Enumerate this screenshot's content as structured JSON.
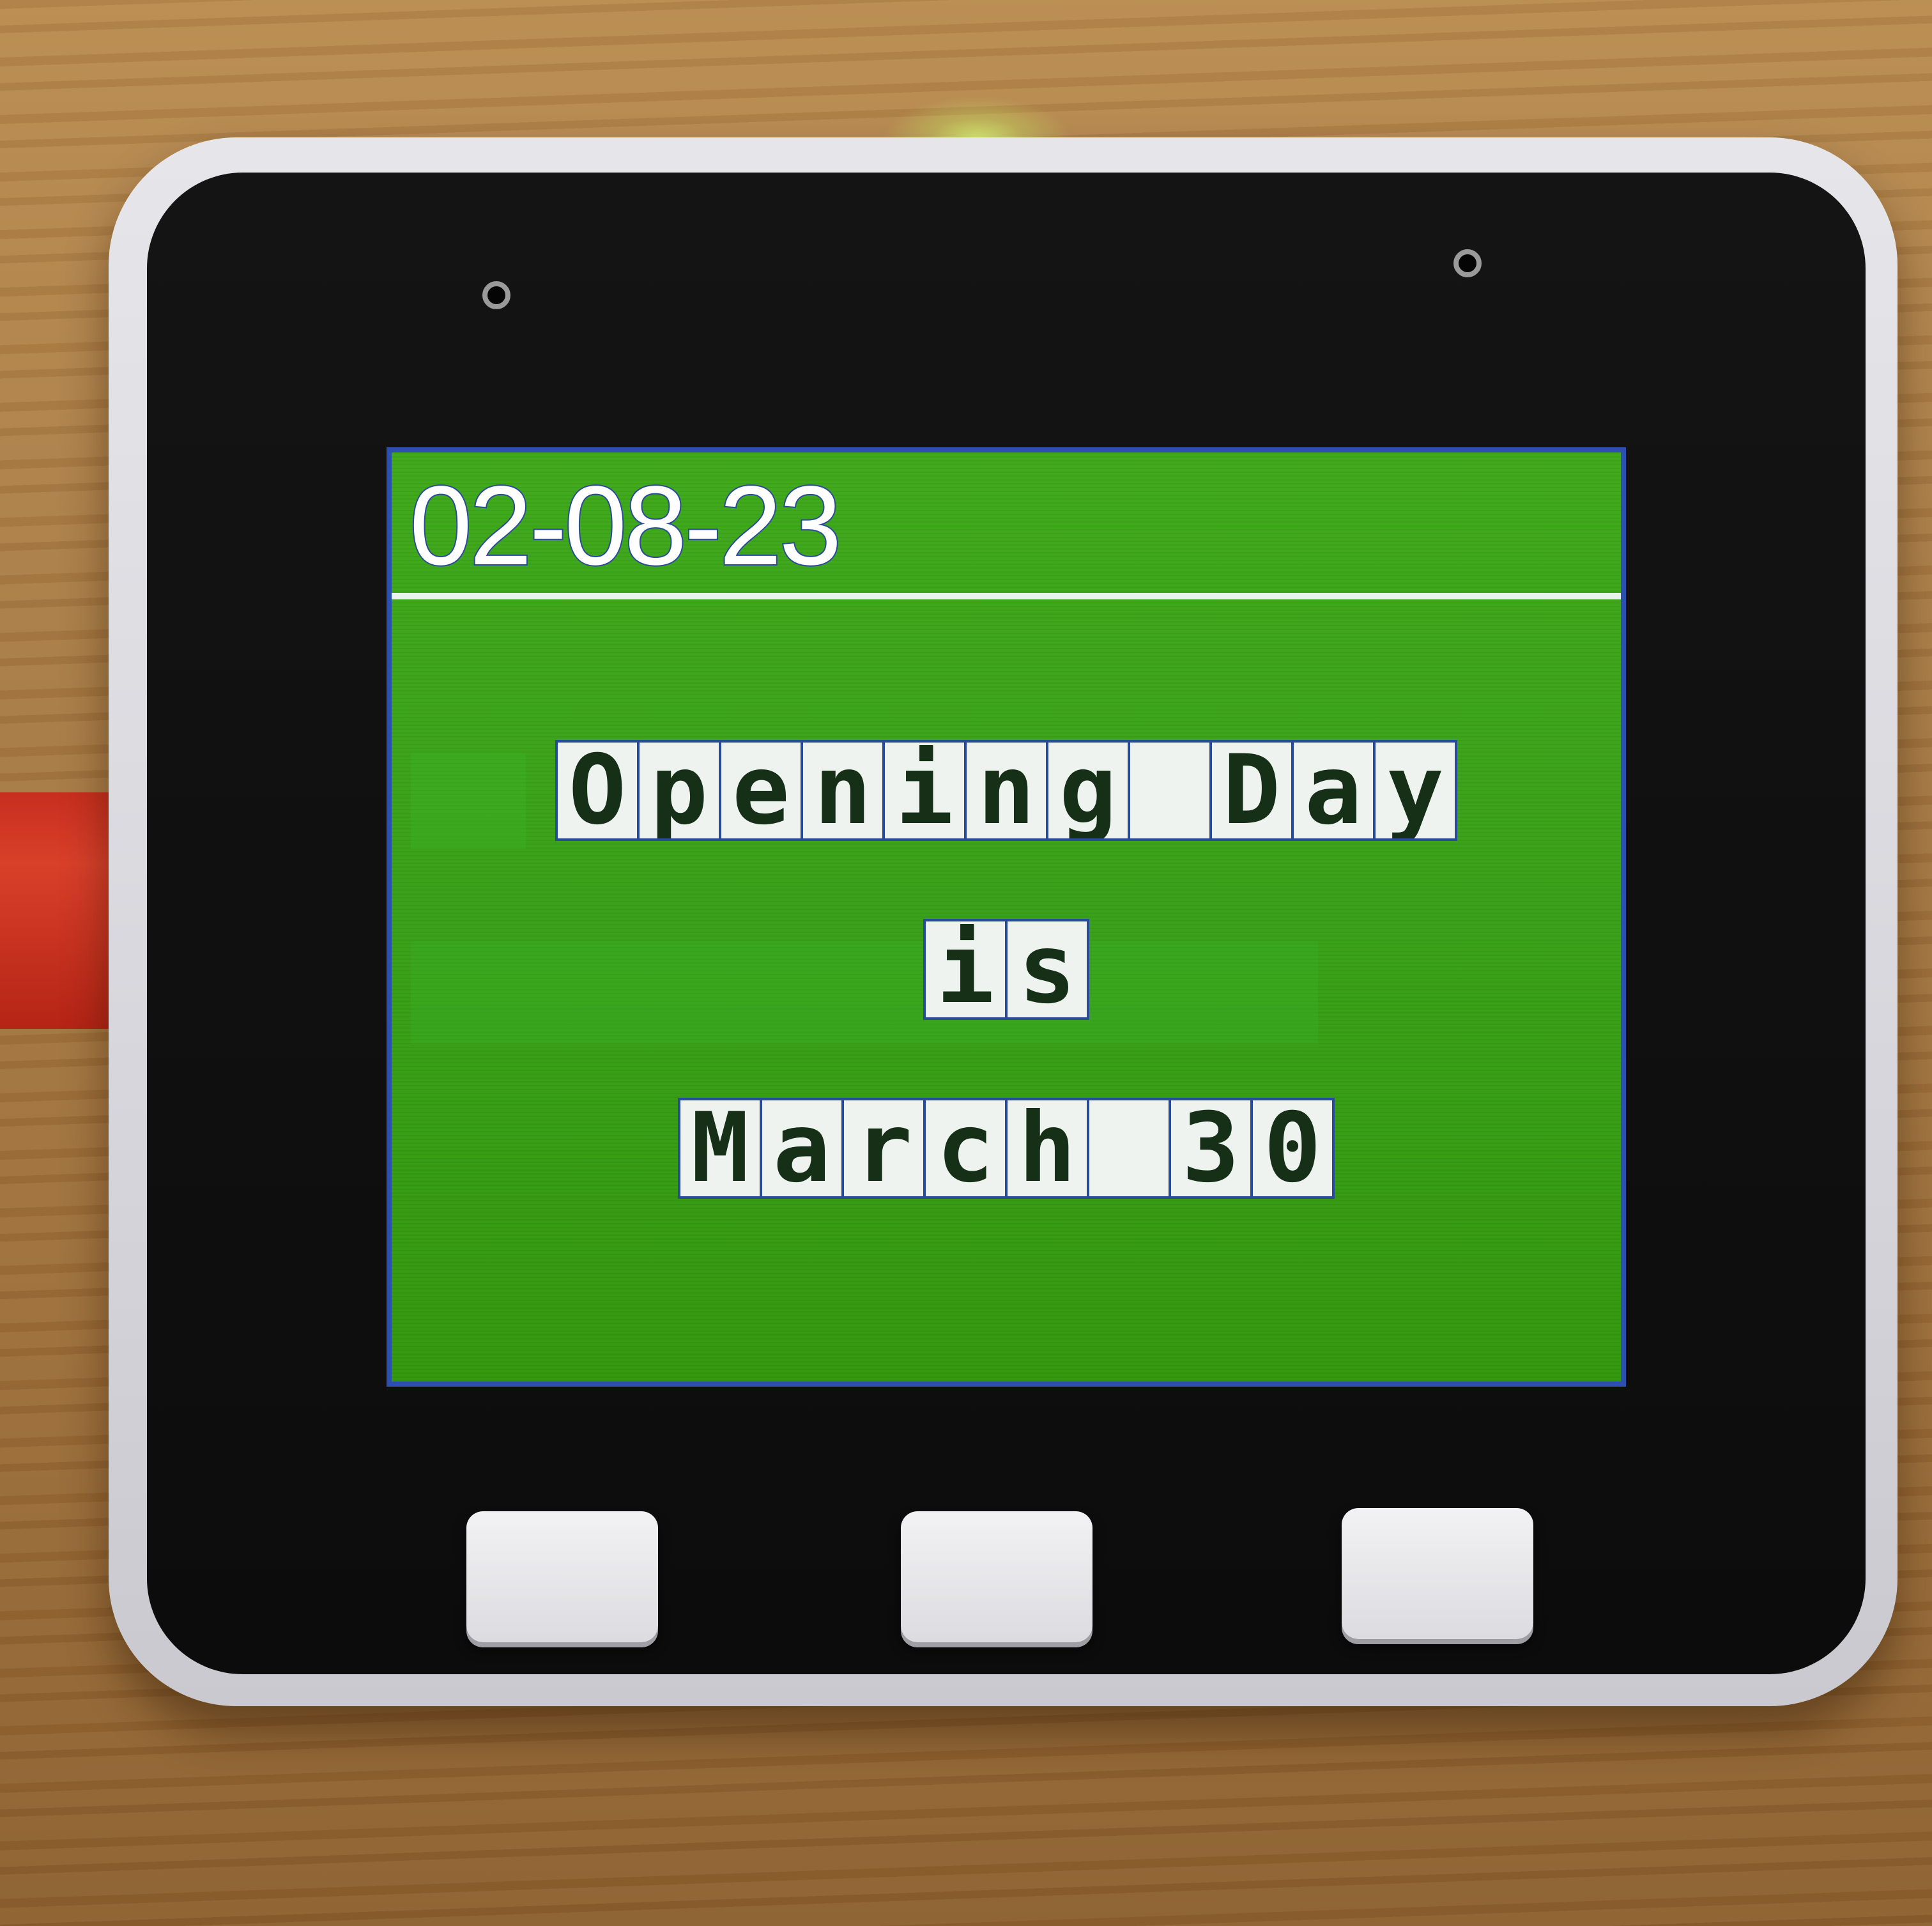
{
  "screen": {
    "date": "02-08-23",
    "message_lines": [
      "Opening Day",
      "is",
      "March 30"
    ]
  },
  "device": {
    "buttons": [
      "button-a",
      "button-b",
      "button-c"
    ]
  }
}
